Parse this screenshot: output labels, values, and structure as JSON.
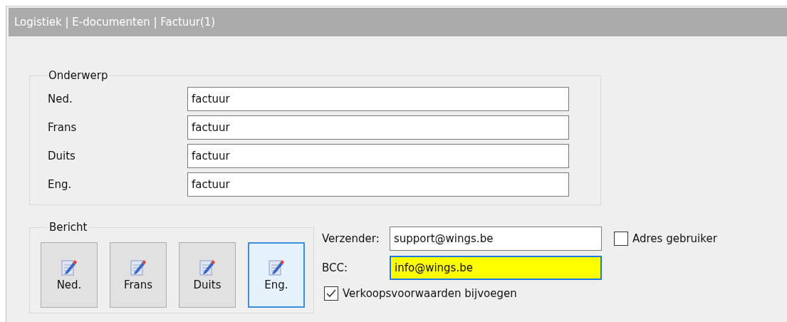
{
  "window": {
    "title": "Logistiek | E-documenten | Factuur(1)"
  },
  "subject": {
    "title": "Onderwerp",
    "rows": [
      {
        "label": "Ned.",
        "value": "factuur"
      },
      {
        "label": "Frans",
        "value": "factuur"
      },
      {
        "label": "Duits",
        "value": "factuur"
      },
      {
        "label": "Eng.",
        "value": "factuur"
      }
    ]
  },
  "message": {
    "title": "Bericht",
    "buttons": [
      {
        "label": "Ned.",
        "selected": false
      },
      {
        "label": "Frans",
        "selected": false
      },
      {
        "label": "Duits",
        "selected": false
      },
      {
        "label": "Eng.",
        "selected": true
      }
    ]
  },
  "sender": {
    "label": "Verzender:",
    "value": "support@wings.be",
    "highlighted": false
  },
  "bcc": {
    "label": "BCC:",
    "value": "info@wings.be",
    "highlighted": true
  },
  "use_user_address": {
    "label": "Adres gebruiker",
    "checked": false
  },
  "attach_terms": {
    "label": "Verkoopsvoorwaarden bijvoegen",
    "checked": true
  }
}
